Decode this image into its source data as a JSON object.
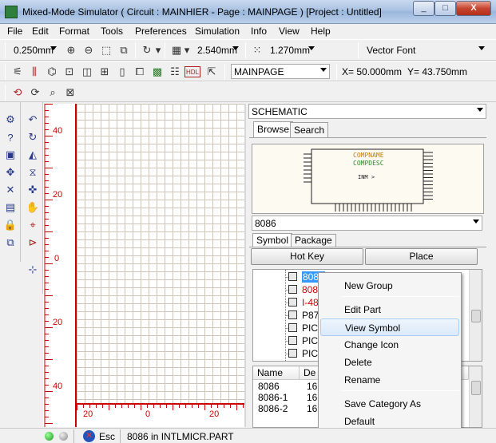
{
  "window": {
    "title": "Mixed-Mode Simulator ( Circuit : MAINHIER - Page : MAINPAGE ) [Project : Untitled]",
    "min": "_",
    "max": "□",
    "close": "X"
  },
  "menu": [
    "File",
    "Edit",
    "Format",
    "Tools",
    "Preferences",
    "Simulation",
    "Info",
    "View",
    "Help"
  ],
  "toolbar1": {
    "line_width": "0.250mm",
    "grid_size": "2.540mm",
    "snap_size": "1.270mm",
    "font": "Vector Font"
  },
  "toolbar2": {
    "page": "MAINPAGE",
    "coord_x": "X= 50.000mm",
    "coord_y": "Y= 43.750mm",
    "hdl_label": "HDL"
  },
  "rulers": {
    "vertical": [
      "40",
      "20",
      "0",
      "20",
      "40"
    ],
    "horizontal": [
      "20",
      "0",
      "20"
    ]
  },
  "panel": {
    "mode": "SCHEMATIC",
    "tabs": [
      "Browse",
      "Search"
    ],
    "preview": {
      "compname": "COMPNAME",
      "compdesc": "COMPDESC",
      "center_text": "INM > "
    },
    "part_value": "8086",
    "subtabs": [
      "Symbol",
      "Package"
    ],
    "hotkey_button": "Hot Key",
    "place_button": "Place",
    "tree_items": [
      "8086",
      "8088",
      "I-48",
      "P87",
      "PIC1",
      "PIC1",
      "PIC1"
    ],
    "list_columns": [
      "Name",
      "De"
    ],
    "list_rows": [
      [
        "8086",
        "16"
      ],
      [
        "8086-1",
        "16"
      ],
      [
        "8086-2",
        "16"
      ]
    ]
  },
  "context_menu": {
    "items": [
      "New Group",
      "Edit Part",
      "View Symbol",
      "Change Icon",
      "Delete",
      "Rename",
      "Save Category As",
      "Default"
    ],
    "highlighted": "View Symbol"
  },
  "status": {
    "esc_label": "Esc",
    "message": "8086 in INTLMICR.PART"
  },
  "colors": {
    "ruler": "#cc0000",
    "grid": "#ccc5b8",
    "preview_title": "#c08000",
    "preview_desc": "#2a8a2a"
  }
}
